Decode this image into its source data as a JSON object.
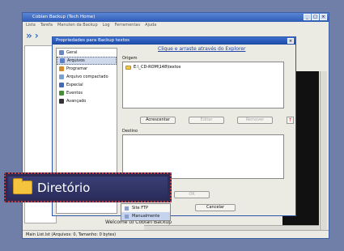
{
  "main_window": {
    "title": "Cobian Backup (Tech Home)",
    "menu": [
      "Lista",
      "Tarefa",
      "Manuten da Backup",
      "Log",
      "Ferramentas",
      "Ajuda"
    ],
    "status_text": "Main List.lst (Arquivos: 0, Tamanho: 0 bytes)",
    "welcome_text": "Welcome to Cobian Backup"
  },
  "dialog": {
    "title": "Propriedades para Backup textos",
    "hint_link": "Clique e arraste através do Explorer",
    "sidebar_items": [
      {
        "label": "Geral",
        "color": "#6f86c0"
      },
      {
        "label": "Arquivos",
        "color": "#5a7fc8"
      },
      {
        "label": "Programar",
        "color": "#d38b2b"
      },
      {
        "label": "Arquivo compactado",
        "color": "#7b9fd3"
      },
      {
        "label": "Especial",
        "color": "#4468b5"
      },
      {
        "label": "Eventos",
        "color": "#4b8c3a"
      },
      {
        "label": "Avançado",
        "color": "#333333"
      }
    ],
    "origin_label": "Origem",
    "origin_path": "E:\\_CD-ROM\\148\\textos",
    "add_button": "Acrescentar",
    "edit_button": "Editar",
    "remove_button": "Remover",
    "dest_label": "Destino",
    "ok_button": "OK",
    "cancel_button": "Cancelar"
  },
  "callout": {
    "label": "Diretório"
  },
  "popup_menu": {
    "items": [
      "Site FTP",
      "Manualmente"
    ]
  },
  "colors": {
    "accent": "#2f5cb4",
    "callout_border": "#c43a3a"
  }
}
